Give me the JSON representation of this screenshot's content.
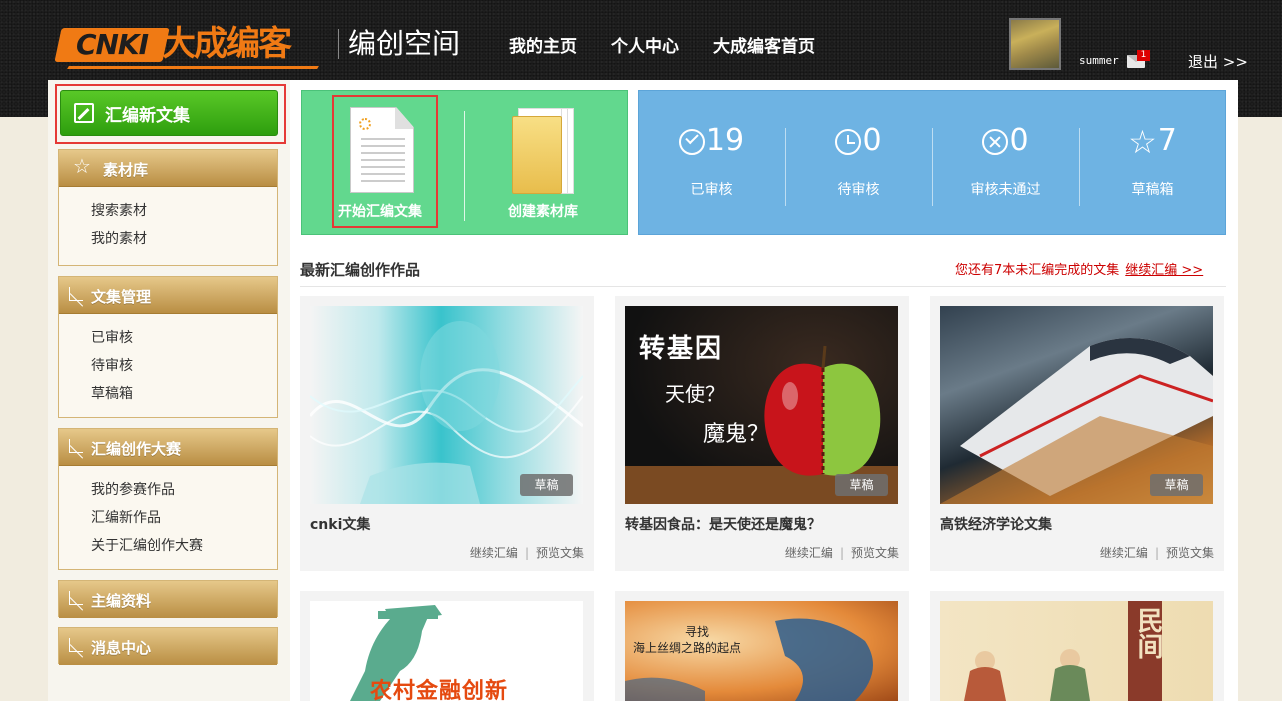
{
  "header": {
    "logo_prefix": "CNKI",
    "logo_brand": "大成编客",
    "site_title": "编创空间",
    "nav": [
      "我的主页",
      "个人中心",
      "大成编客首页"
    ],
    "username": "summer",
    "mail_count": "1",
    "logout": "退出 >>"
  },
  "sidebar": {
    "new_button": "汇编新文集",
    "sections": [
      {
        "title": "素材库",
        "icon": "star-icon",
        "items": [
          "搜索素材",
          "我的素材"
        ]
      },
      {
        "title": "文集管理",
        "icon": "arrow-icon",
        "items": [
          "已审核",
          "待审核",
          "草稿箱"
        ]
      },
      {
        "title": "汇编创作大赛",
        "icon": "arrow-icon",
        "items": [
          "我的参赛作品",
          "汇编新作品",
          "关于汇编创作大赛"
        ]
      },
      {
        "title": "主编资料",
        "icon": "arrow-icon",
        "items": []
      },
      {
        "title": "消息中心",
        "icon": "arrow-icon",
        "items": []
      }
    ]
  },
  "actions": {
    "start": "开始汇编文集",
    "create": "创建素材库"
  },
  "stats": [
    {
      "value": "19",
      "label": "已审核",
      "icon": "check-circle-icon"
    },
    {
      "value": "0",
      "label": "待审核",
      "icon": "clock-icon"
    },
    {
      "value": "0",
      "label": "审核未通过",
      "icon": "x-circle-icon"
    },
    {
      "value": "7",
      "label": "草稿箱",
      "icon": "star-icon"
    }
  ],
  "latest": {
    "title": "最新汇编创作作品",
    "notice": "您还有7本未汇编完成的文集",
    "continue_link": "继续汇编 >>"
  },
  "cards": [
    {
      "title": "cnki文集",
      "tag": "草稿",
      "action1": "继续汇编",
      "action2": "预览文集"
    },
    {
      "title": "转基因食品：是天使还是魔鬼？",
      "tag": "草稿",
      "action1": "继续汇编",
      "action2": "预览文集",
      "art_text": [
        "转基因",
        "天使？",
        "魔鬼？"
      ]
    },
    {
      "title": "高铁经济学论文集",
      "tag": "草稿",
      "action1": "继续汇编",
      "action2": "预览文集"
    },
    {
      "art_text": [
        "农村金融创新"
      ]
    },
    {
      "art_text": [
        "寻找",
        "海上丝绸之路的起点"
      ]
    },
    {
      "art_text": [
        "民间"
      ]
    }
  ],
  "colors": {
    "accent_orange": "#f07a14",
    "green_button": "#3fb11a",
    "green_tile": "#62d88e",
    "blue_tile": "#6eb3e3",
    "highlight_red": "#e53935"
  }
}
